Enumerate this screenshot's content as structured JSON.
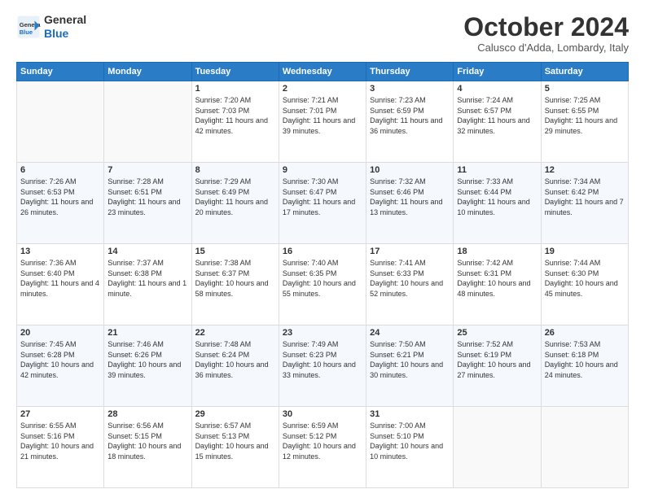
{
  "logo": {
    "line1": "General",
    "line2": "Blue"
  },
  "title": "October 2024",
  "subtitle": "Calusco d'Adda, Lombardy, Italy",
  "weekdays": [
    "Sunday",
    "Monday",
    "Tuesday",
    "Wednesday",
    "Thursday",
    "Friday",
    "Saturday"
  ],
  "weeks": [
    [
      {
        "day": "",
        "info": ""
      },
      {
        "day": "",
        "info": ""
      },
      {
        "day": "1",
        "info": "Sunrise: 7:20 AM\nSunset: 7:03 PM\nDaylight: 11 hours and 42 minutes."
      },
      {
        "day": "2",
        "info": "Sunrise: 7:21 AM\nSunset: 7:01 PM\nDaylight: 11 hours and 39 minutes."
      },
      {
        "day": "3",
        "info": "Sunrise: 7:23 AM\nSunset: 6:59 PM\nDaylight: 11 hours and 36 minutes."
      },
      {
        "day": "4",
        "info": "Sunrise: 7:24 AM\nSunset: 6:57 PM\nDaylight: 11 hours and 32 minutes."
      },
      {
        "day": "5",
        "info": "Sunrise: 7:25 AM\nSunset: 6:55 PM\nDaylight: 11 hours and 29 minutes."
      }
    ],
    [
      {
        "day": "6",
        "info": "Sunrise: 7:26 AM\nSunset: 6:53 PM\nDaylight: 11 hours and 26 minutes."
      },
      {
        "day": "7",
        "info": "Sunrise: 7:28 AM\nSunset: 6:51 PM\nDaylight: 11 hours and 23 minutes."
      },
      {
        "day": "8",
        "info": "Sunrise: 7:29 AM\nSunset: 6:49 PM\nDaylight: 11 hours and 20 minutes."
      },
      {
        "day": "9",
        "info": "Sunrise: 7:30 AM\nSunset: 6:47 PM\nDaylight: 11 hours and 17 minutes."
      },
      {
        "day": "10",
        "info": "Sunrise: 7:32 AM\nSunset: 6:46 PM\nDaylight: 11 hours and 13 minutes."
      },
      {
        "day": "11",
        "info": "Sunrise: 7:33 AM\nSunset: 6:44 PM\nDaylight: 11 hours and 10 minutes."
      },
      {
        "day": "12",
        "info": "Sunrise: 7:34 AM\nSunset: 6:42 PM\nDaylight: 11 hours and 7 minutes."
      }
    ],
    [
      {
        "day": "13",
        "info": "Sunrise: 7:36 AM\nSunset: 6:40 PM\nDaylight: 11 hours and 4 minutes."
      },
      {
        "day": "14",
        "info": "Sunrise: 7:37 AM\nSunset: 6:38 PM\nDaylight: 11 hours and 1 minute."
      },
      {
        "day": "15",
        "info": "Sunrise: 7:38 AM\nSunset: 6:37 PM\nDaylight: 10 hours and 58 minutes."
      },
      {
        "day": "16",
        "info": "Sunrise: 7:40 AM\nSunset: 6:35 PM\nDaylight: 10 hours and 55 minutes."
      },
      {
        "day": "17",
        "info": "Sunrise: 7:41 AM\nSunset: 6:33 PM\nDaylight: 10 hours and 52 minutes."
      },
      {
        "day": "18",
        "info": "Sunrise: 7:42 AM\nSunset: 6:31 PM\nDaylight: 10 hours and 48 minutes."
      },
      {
        "day": "19",
        "info": "Sunrise: 7:44 AM\nSunset: 6:30 PM\nDaylight: 10 hours and 45 minutes."
      }
    ],
    [
      {
        "day": "20",
        "info": "Sunrise: 7:45 AM\nSunset: 6:28 PM\nDaylight: 10 hours and 42 minutes."
      },
      {
        "day": "21",
        "info": "Sunrise: 7:46 AM\nSunset: 6:26 PM\nDaylight: 10 hours and 39 minutes."
      },
      {
        "day": "22",
        "info": "Sunrise: 7:48 AM\nSunset: 6:24 PM\nDaylight: 10 hours and 36 minutes."
      },
      {
        "day": "23",
        "info": "Sunrise: 7:49 AM\nSunset: 6:23 PM\nDaylight: 10 hours and 33 minutes."
      },
      {
        "day": "24",
        "info": "Sunrise: 7:50 AM\nSunset: 6:21 PM\nDaylight: 10 hours and 30 minutes."
      },
      {
        "day": "25",
        "info": "Sunrise: 7:52 AM\nSunset: 6:19 PM\nDaylight: 10 hours and 27 minutes."
      },
      {
        "day": "26",
        "info": "Sunrise: 7:53 AM\nSunset: 6:18 PM\nDaylight: 10 hours and 24 minutes."
      }
    ],
    [
      {
        "day": "27",
        "info": "Sunrise: 6:55 AM\nSunset: 5:16 PM\nDaylight: 10 hours and 21 minutes."
      },
      {
        "day": "28",
        "info": "Sunrise: 6:56 AM\nSunset: 5:15 PM\nDaylight: 10 hours and 18 minutes."
      },
      {
        "day": "29",
        "info": "Sunrise: 6:57 AM\nSunset: 5:13 PM\nDaylight: 10 hours and 15 minutes."
      },
      {
        "day": "30",
        "info": "Sunrise: 6:59 AM\nSunset: 5:12 PM\nDaylight: 10 hours and 12 minutes."
      },
      {
        "day": "31",
        "info": "Sunrise: 7:00 AM\nSunset: 5:10 PM\nDaylight: 10 hours and 10 minutes."
      },
      {
        "day": "",
        "info": ""
      },
      {
        "day": "",
        "info": ""
      }
    ]
  ]
}
